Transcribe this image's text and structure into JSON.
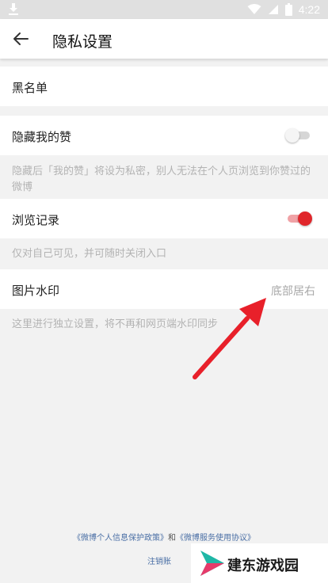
{
  "status_bar": {
    "time": "4:22"
  },
  "header": {
    "title": "隐私设置"
  },
  "settings": {
    "blacklist": {
      "label": "黑名单"
    },
    "hide_likes": {
      "label": "隐藏我的赞",
      "enabled": false,
      "hint": "隐藏后「我的赞」将设为私密，别人无法在个人页浏览到你赞过的微博"
    },
    "browse_history": {
      "label": "浏览记录",
      "enabled": true,
      "hint": "仅对自己可见，并可随时关闭入口"
    },
    "image_watermark": {
      "label": "图片水印",
      "value": "底部居右",
      "hint": "这里进行独立设置，将不再和网页端水印同步"
    }
  },
  "footer": {
    "privacy_policy": "《微博个人信息保护政策》",
    "conjunction": "和",
    "service_agreement": "《微博服务使用协议》",
    "logout": "注销账"
  },
  "watermark": {
    "text": "建东游戏园"
  },
  "colors": {
    "accent": "#e0262b",
    "arrow": "#e8202a",
    "link": "#4a6fa5"
  }
}
